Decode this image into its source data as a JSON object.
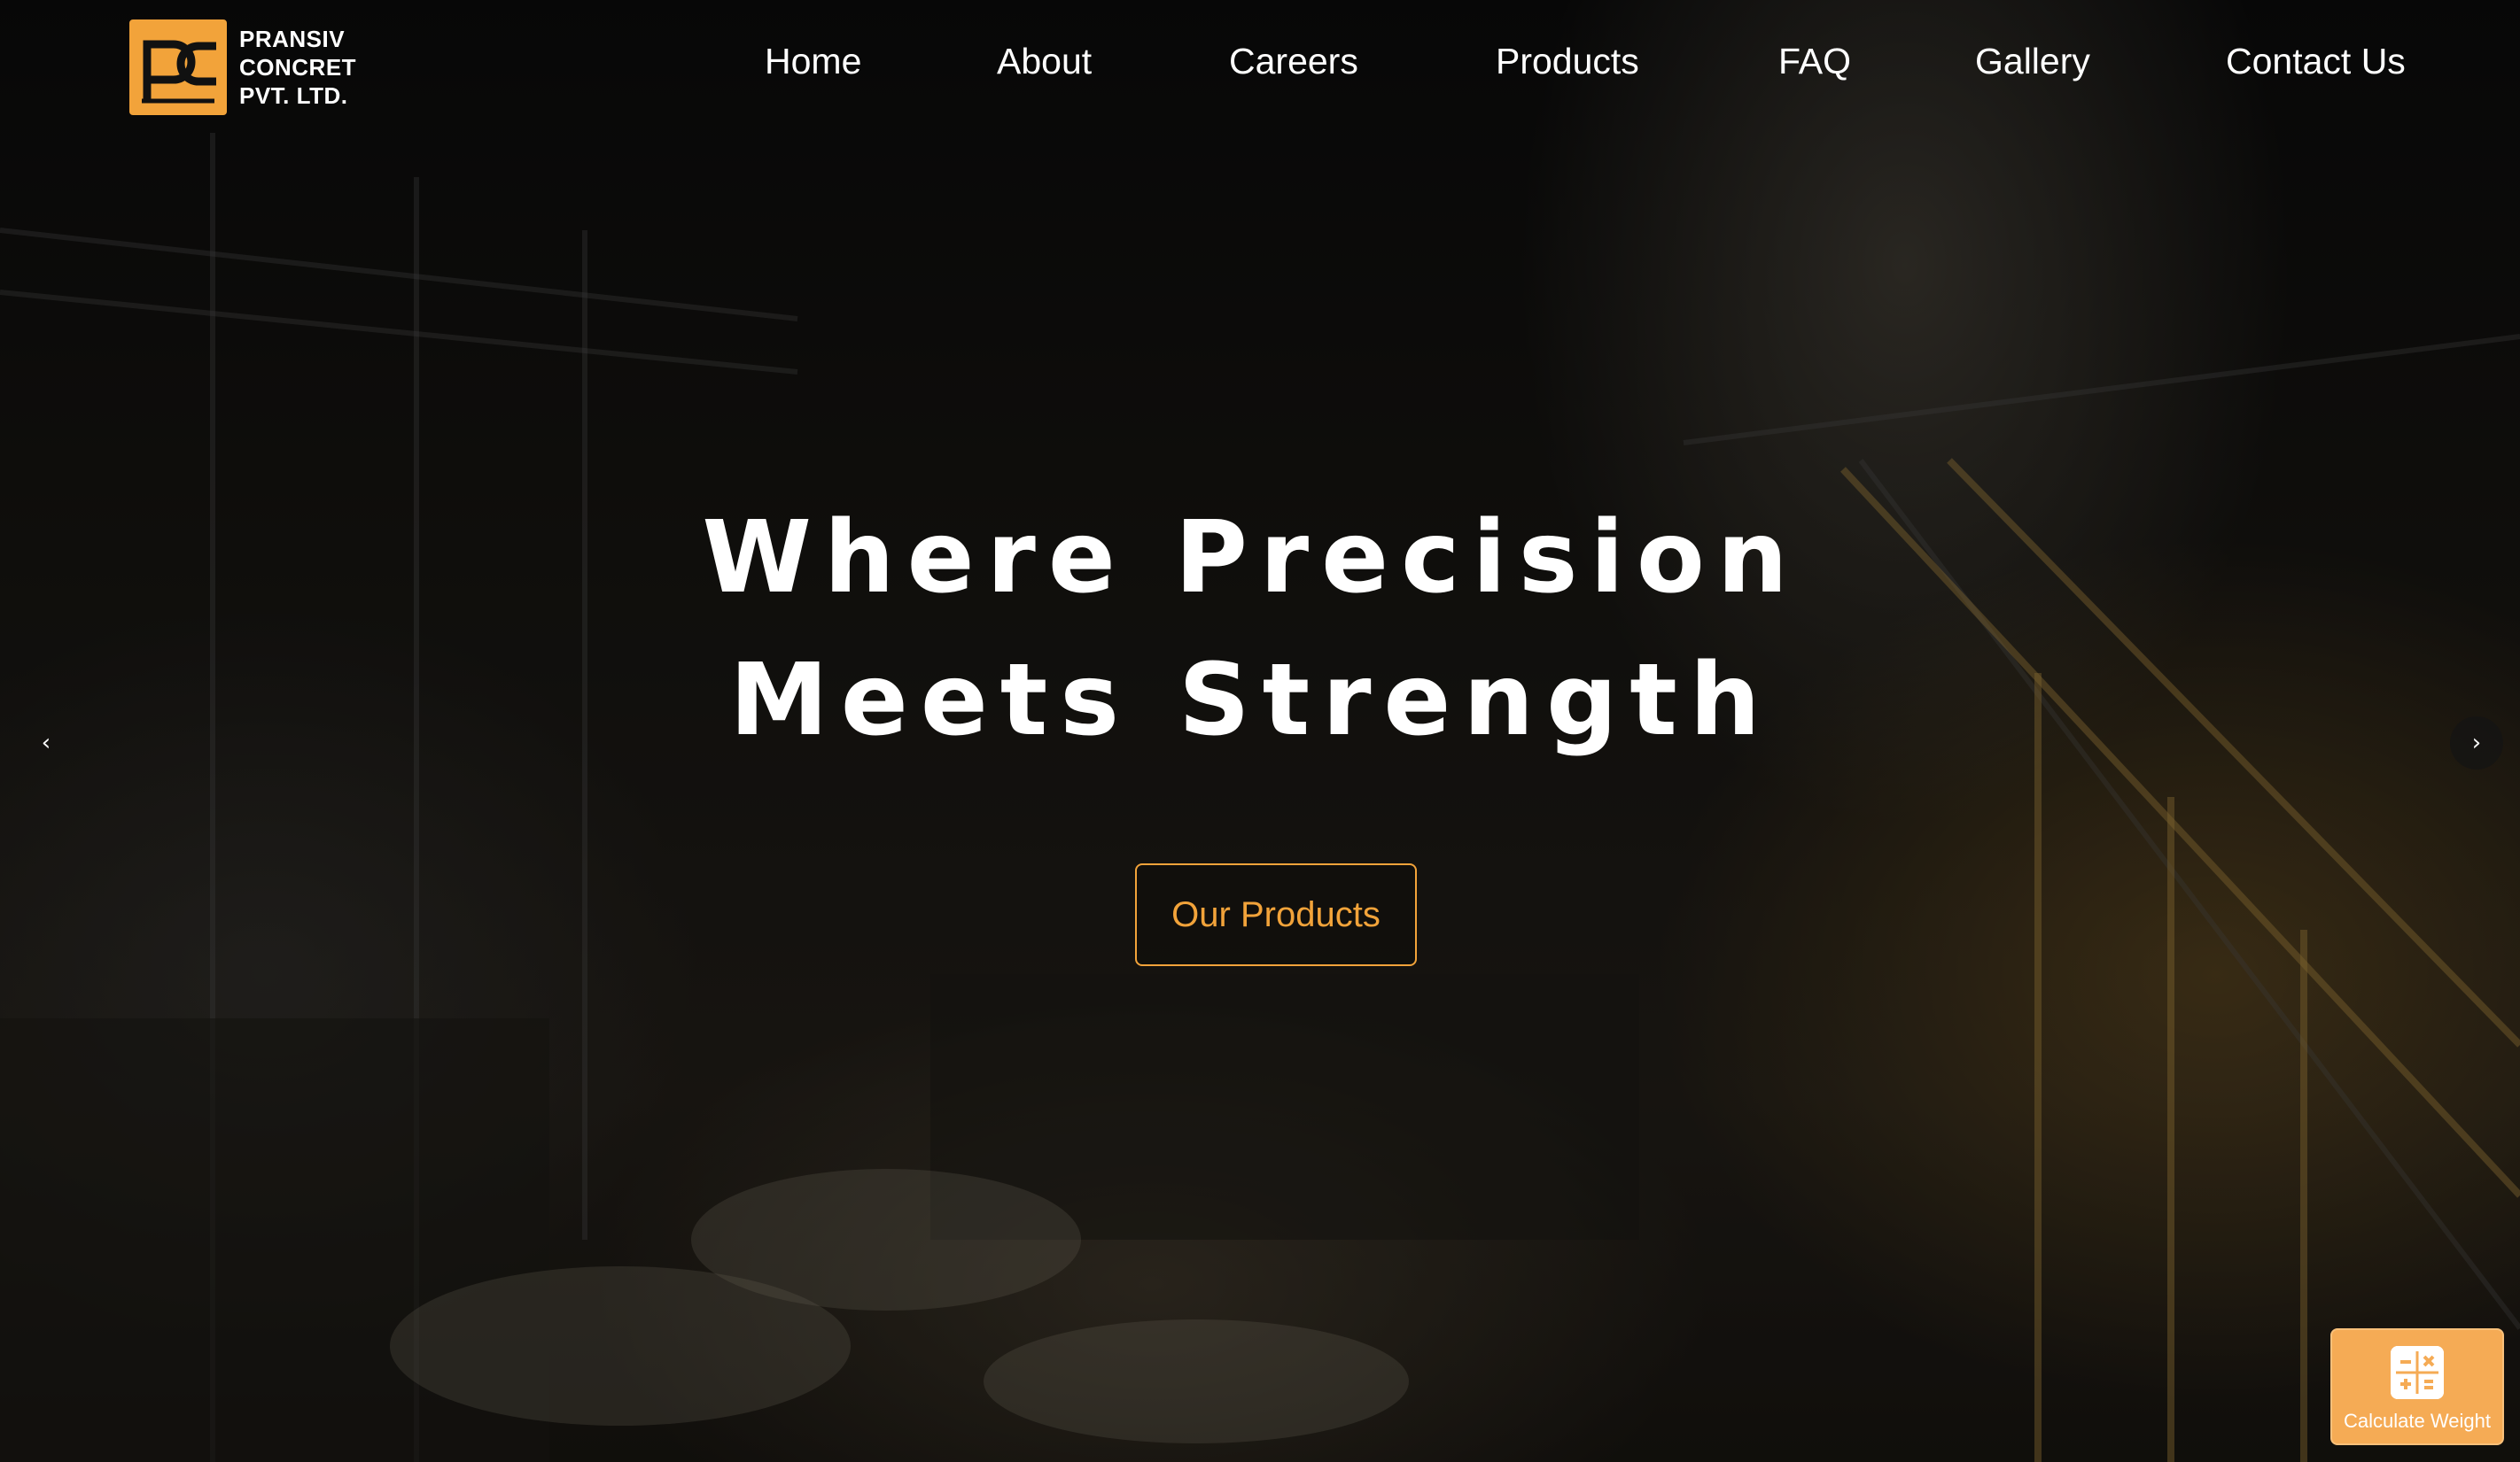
{
  "brand": {
    "line1": "PRANSIV",
    "line2": "CONCRET",
    "line3": "PVT. LTD.",
    "accent_color": "#f2a33a",
    "logo_icon": "pc-monogram-icon"
  },
  "nav": {
    "items": [
      {
        "label": "Home"
      },
      {
        "label": "About"
      },
      {
        "label": "Careers"
      },
      {
        "label": "Products"
      },
      {
        "label": "FAQ"
      },
      {
        "label": "Gallery"
      },
      {
        "label": "Contact Us"
      }
    ]
  },
  "hero": {
    "headline_line1": "Where Precision",
    "headline_line2": "Meets Strength",
    "cta_label": "Our Products",
    "prev_icon": "chevron-left-icon",
    "next_icon": "chevron-right-icon",
    "prev_glyph": "‹",
    "next_glyph": "›"
  },
  "widget": {
    "label": "Calculate Weight",
    "icon": "calculator-icon",
    "color": "#f5ab55"
  }
}
